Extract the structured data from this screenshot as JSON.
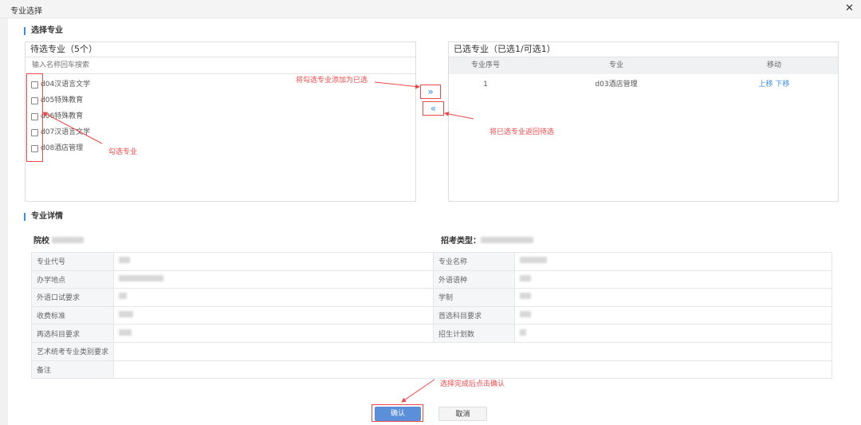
{
  "dialog": {
    "title": "专业选择",
    "close_icon": "close-icon"
  },
  "select_section": {
    "title": "选择专业"
  },
  "available": {
    "header": "待选专业（5个）",
    "search_placeholder": "输入名称回车搜索",
    "items": [
      {
        "label": "d04汉语言文学",
        "checked": false
      },
      {
        "label": "d05特殊教育",
        "checked": false
      },
      {
        "label": "d06特殊教育",
        "checked": false
      },
      {
        "label": "d07汉语言文学",
        "checked": false
      },
      {
        "label": "d08酒店管理",
        "checked": false
      }
    ]
  },
  "transfer": {
    "add_icon": "double-chevron-right-icon",
    "remove_icon": "double-chevron-left-icon"
  },
  "selected": {
    "header": "已选专业（已选1/可选1）",
    "columns": [
      "专业序号",
      "专业",
      "移动"
    ],
    "rows": [
      {
        "index": "1",
        "major": "d03酒店管理",
        "move_up": "上移",
        "move_down": "下移"
      }
    ]
  },
  "detail_section": {
    "title": "专业详情",
    "school_label": "院校",
    "exam_type_label": "招考类型：",
    "rows": [
      [
        "专业代号",
        "专业名称"
      ],
      [
        "办学地点",
        "外语语种"
      ],
      [
        "外语口试要求",
        "学制"
      ],
      [
        "收费标准",
        "首选科目要求"
      ],
      [
        "再选科目要求",
        "招生计划数"
      ]
    ],
    "full_rows": [
      "艺术统考专业类别要求",
      "备注"
    ]
  },
  "annotations": {
    "check": "勾选专业",
    "add": "将勾选专业添加为已选",
    "remove": "将已选专业返回待选",
    "confirm": "选择完成后点击确认"
  },
  "footer": {
    "confirm": "确认",
    "cancel": "取消"
  },
  "colors": {
    "accent": "#3b8cf0",
    "annotation": "#f04848",
    "confirm_bg": "#5b8fd9"
  }
}
